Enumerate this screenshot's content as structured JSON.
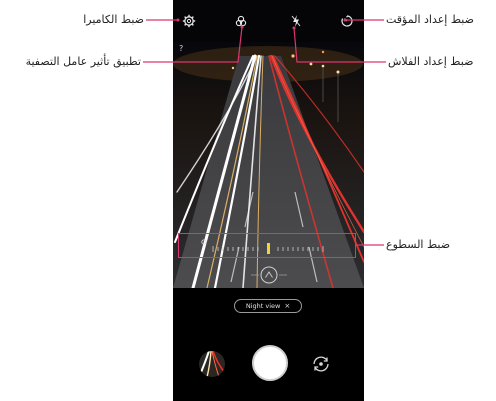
{
  "labels": {
    "camera_settings": "ضبط الكاميرا",
    "timer_settings": "ضبط إعداد المؤقت",
    "filter_effect": "تطبيق تأثير عامل التصفية",
    "flash_settings": "ضبط إعداد الفلاش",
    "brightness": "ضبط السطوع"
  },
  "camera": {
    "night_view_chip": "Night view",
    "night_view_close": "×",
    "help_hint": "?"
  },
  "colors": {
    "callout_line": "#d9376e",
    "screen_bg": "#0b0b10"
  },
  "icons": {
    "settings": "gear-icon",
    "filter": "filter-icon",
    "flash": "flash-icon",
    "timer": "timer-icon",
    "brightness_dim": "sun-dim-icon",
    "brightness_bright": "moon-icon",
    "switch_camera": "switch-camera-icon"
  }
}
